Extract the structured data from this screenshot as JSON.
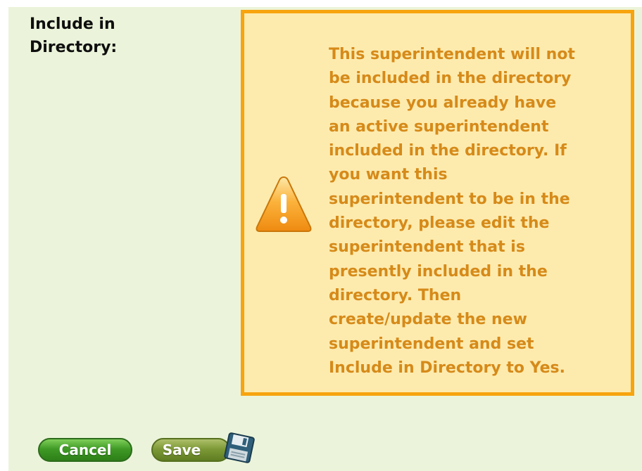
{
  "form": {
    "field_label": "Include in\nDirectory:"
  },
  "warning": {
    "icon": "warning-triangle-icon",
    "message": "This superintendent will not\nbe included in the directory\nbecause you already have\nan active superintendent\nincluded in the directory. If\nyou want this\nsuperintendent to be in the\ndirectory, please edit the\nsuperintendent that is\npresently included in the\ndirectory. Then\ncreate/update the new\nsuperintendent and set\nInclude in Directory to Yes."
  },
  "buttons": {
    "cancel_label": "Cancel",
    "save_label": "Save",
    "save_icon": "floppy-disk-icon"
  },
  "colors": {
    "panel_background": "#ebf4da",
    "warning_background": "#fdebae",
    "warning_border": "#f7a40f",
    "warning_text": "#d68a19",
    "cancel_button": "#3f9a25",
    "save_button": "#7e9a37"
  }
}
